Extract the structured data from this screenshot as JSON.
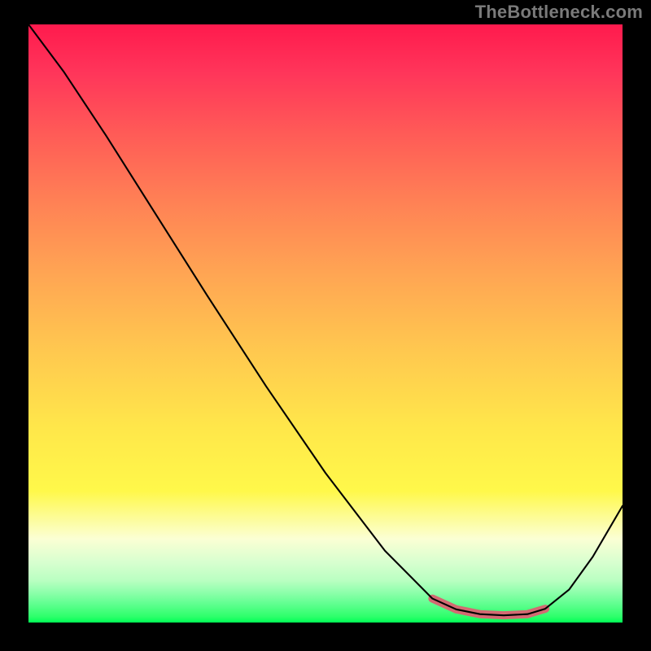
{
  "watermark": "TheBottleneck.com",
  "chart_data": {
    "type": "line",
    "title": "",
    "xlabel": "",
    "ylabel": "",
    "series": [
      {
        "name": "black-curve",
        "x": [
          0.0,
          0.06,
          0.13,
          0.2,
          0.3,
          0.4,
          0.5,
          0.6,
          0.68,
          0.72,
          0.76,
          0.8,
          0.84,
          0.87,
          0.91,
          0.95,
          1.0
        ],
        "y": [
          1.0,
          0.92,
          0.815,
          0.705,
          0.548,
          0.395,
          0.25,
          0.12,
          0.04,
          0.022,
          0.014,
          0.012,
          0.014,
          0.023,
          0.055,
          0.11,
          0.195
        ],
        "color": "#000000",
        "stroke_width": 2.1
      },
      {
        "name": "pink-highlight",
        "x": [
          0.68,
          0.72,
          0.76,
          0.8,
          0.84,
          0.87
        ],
        "y": [
          0.04,
          0.022,
          0.014,
          0.012,
          0.014,
          0.023
        ],
        "color": "#d36a72",
        "stroke_width": 10
      }
    ],
    "xlim": [
      0,
      1
    ],
    "ylim": [
      0,
      1
    ],
    "legend": false,
    "grid": false,
    "background": "rainbow-gradient"
  }
}
